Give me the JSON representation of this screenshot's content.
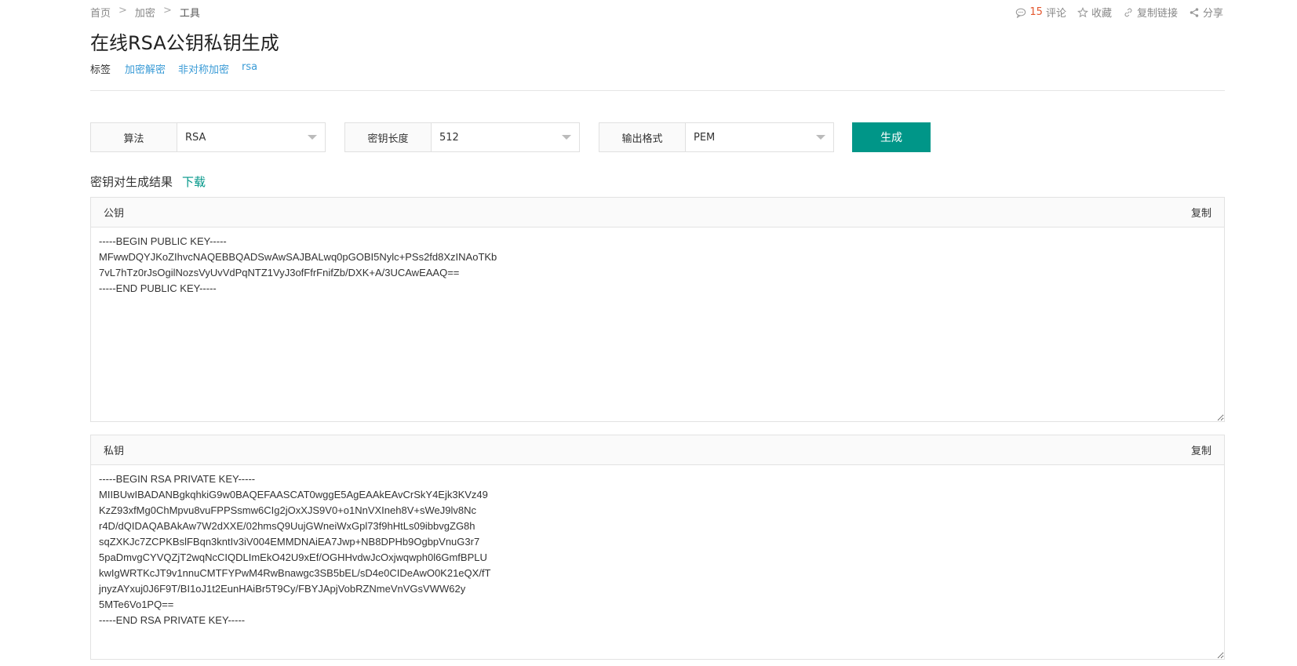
{
  "breadcrumb": [
    "首页",
    "加密",
    "工具"
  ],
  "actions": {
    "comment_count": "15",
    "comment_label": "评论",
    "favorite_label": "收藏",
    "copy_link_label": "复制链接",
    "share_label": "分享"
  },
  "page_title": "在线RSA公钥私钥生成",
  "tags": {
    "label": "标签",
    "items": [
      "加密解密",
      "非对称加密",
      "rsa"
    ]
  },
  "controls": {
    "algorithm": {
      "label": "算法",
      "value": "RSA"
    },
    "key_length": {
      "label": "密钥长度",
      "value": "512"
    },
    "output_format": {
      "label": "输出格式",
      "value": "PEM"
    },
    "generate_label": "生成"
  },
  "result": {
    "title": "密钥对生成结果",
    "download_label": "下载"
  },
  "public_key": {
    "title": "公钥",
    "copy_label": "复制",
    "content": "-----BEGIN PUBLIC KEY-----\nMFwwDQYJKoZIhvcNAQEBBQADSwAwSAJBALwq0pGOBI5Nylc+PSs2fd8XzINAoTKb\n7vL7hTz0rJsOgilNozsVyUvVdPqNTZ1VyJ3ofFfrFnifZb/DXK+A/3UCAwEAAQ==\n-----END PUBLIC KEY-----"
  },
  "private_key": {
    "title": "私钥",
    "copy_label": "复制",
    "content": "-----BEGIN RSA PRIVATE KEY-----\nMIIBUwIBADANBgkqhkiG9w0BAQEFAASCAT0wggE5AgEAAkEAvCrSkY4Ejk3KVz49\nKzZ93xfMg0ChMpvu8vuFPPSsmw6CIg2jOxXJS9V0+o1NnVXIneh8V+sWeJ9lv8Nc\nr4D/dQIDAQABAkAw7W2dXXE/02hmsQ9UujGWneiWxGpl73f9hHtLs09ibbvgZG8h\nsqZXKJc7ZCPKBslFBqn3kntIv3iV004EMMDNAiEA7Jwp+NB8DPHb9OgbpVnuG3r7\n5paDmvgCYVQZjT2wqNcCIQDLImEkO42U9xEf/OGHHvdwJcOxjwqwph0l6GmfBPLU\nkwIgWRTKcJT9v1nnuCMTFYPwM4RwBnawgc3SB5bEL/sD4e0CIDeAwO0K21eQX/fT\njnyzAYxuj0J6F9T/BI1oJ1t2EunHAiBr5T9Cy/FBYJApjVobRZNmeVnVGsVWW62y\n5MTe6Vo1PQ==\n-----END RSA PRIVATE KEY-----"
  }
}
